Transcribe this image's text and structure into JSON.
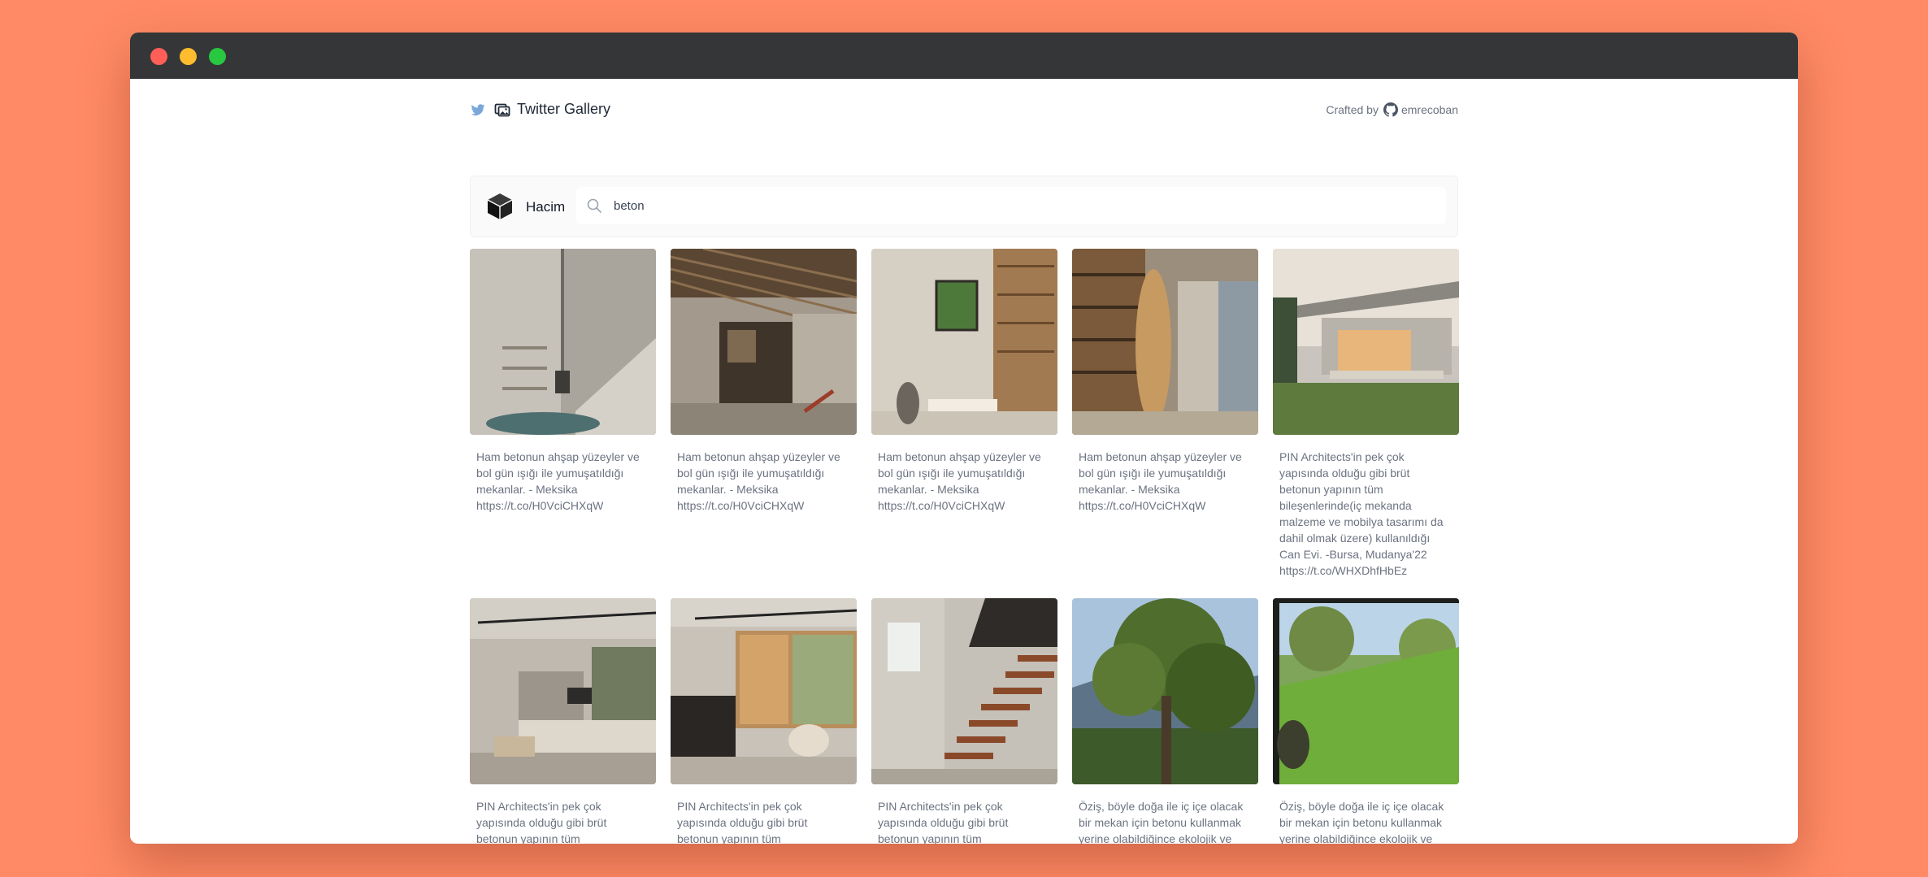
{
  "header": {
    "title": "Twitter Gallery",
    "crafted_by": "Crafted by",
    "author": "emrecoban"
  },
  "search": {
    "brand": "Hacim",
    "value": "beton"
  },
  "colors": {
    "background": "#ff8a65",
    "window_bar": "#353638",
    "caption_text": "#6b7280"
  },
  "cards": [
    {
      "caption": "Ham betonun ahşap yüzeyler ve bol gün ışığı ile yumuşatıldığı mekanlar. - Meksika https://t.co/H0VciCHXqW"
    },
    {
      "caption": "Ham betonun ahşap yüzeyler ve bol gün ışığı ile yumuşatıldığı mekanlar. - Meksika https://t.co/H0VciCHXqW"
    },
    {
      "caption": "Ham betonun ahşap yüzeyler ve bol gün ışığı ile yumuşatıldığı mekanlar. - Meksika https://t.co/H0VciCHXqW"
    },
    {
      "caption": "Ham betonun ahşap yüzeyler ve bol gün ışığı ile yumuşatıldığı mekanlar. - Meksika https://t.co/H0VciCHXqW"
    },
    {
      "caption": "PIN Architects'in pek çok yapısında olduğu gibi brüt betonun yapının tüm bileşenlerinde(iç mekanda malzeme ve mobilya tasarımı da dahil olmak üzere) kullanıldığı Can Evi. -Bursa, Mudanya'22 https://t.co/WHXDhfHbEz"
    },
    {
      "caption": "PIN Architects'in pek çok yapısında olduğu gibi brüt betonun yapının tüm bileşenlerinde(iç mekanda malzeme ve mobilya tasarımı da"
    },
    {
      "caption": "PIN Architects'in pek çok yapısında olduğu gibi brüt betonun yapının tüm bileşenlerinde(iç mekanda malzeme ve mobilya tasarımı da"
    },
    {
      "caption": "PIN Architects'in pek çok yapısında olduğu gibi brüt betonun yapının tüm bileşenlerinde(iç mekanda malzeme ve mobilya tasarımı da"
    },
    {
      "caption": "Öziş, böyle doğa ile iç içe olacak bir mekan için betonu kullanmak yerine olabildiğince ekolojik ve sürdürülebilir bir tasarıma yöneliyor. Bundan sonraki adımı"
    },
    {
      "caption": "Öziş, böyle doğa ile iç içe olacak bir mekan için betonu kullanmak yerine olabildiğince ekolojik ve sürdürülebilir bir tasarıma yöneliyor. Bundan sonraki adımı"
    }
  ]
}
